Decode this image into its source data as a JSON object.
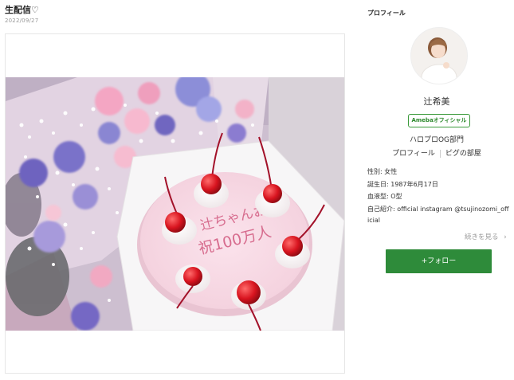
{
  "post": {
    "title": "生配信♡",
    "date": "2022/09/27"
  },
  "sidebar": {
    "heading": "プロフィール",
    "name": "辻希美",
    "badge": "Amebaオフィシャル",
    "group": "ハロプロOG部門",
    "links": [
      "プロフィール",
      "ピグの部屋"
    ],
    "details": {
      "gender": "性別: 女性",
      "birthday": "誕生日: 1987年6月17日",
      "blood": "血液型: O型",
      "intro_line1": "自己紹介: official instagram @tsujinozomi_off",
      "intro_line2": "icial"
    },
    "more": "続きを見る",
    "follow": "+フォロー"
  },
  "cake": {
    "inscription_line1": "辻ちゃんお",
    "inscription_line2": "祝100万人"
  },
  "colors": {
    "follow_green": "#2e8b3a",
    "badge_green": "#3a9a3a",
    "cherry_red": "#d8141f"
  }
}
